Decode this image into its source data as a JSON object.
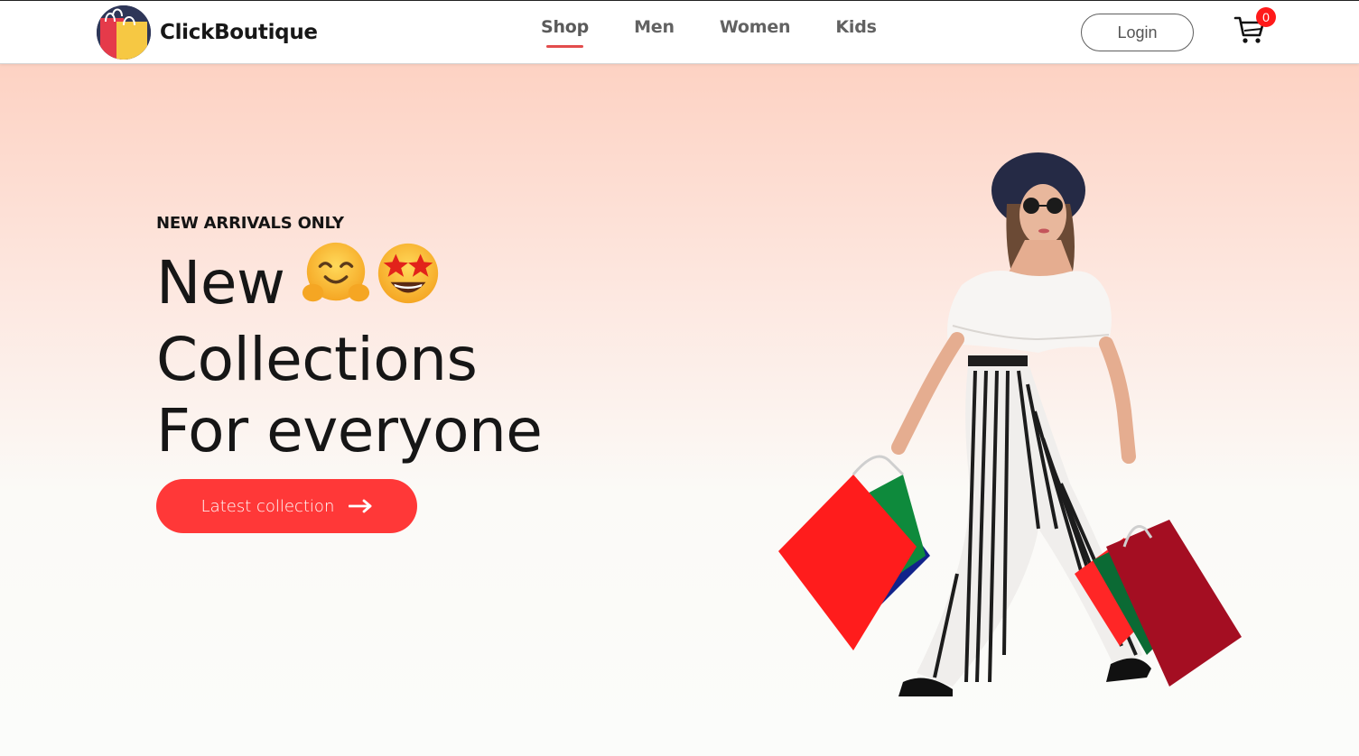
{
  "brand": {
    "name": "ClickBoutique",
    "logo_icon": "shopping-bags-logo-icon"
  },
  "nav": {
    "items": [
      {
        "label": "Shop",
        "active": true
      },
      {
        "label": "Men",
        "active": false
      },
      {
        "label": "Women",
        "active": false
      },
      {
        "label": "Kids",
        "active": false
      }
    ],
    "login_label": "Login",
    "cart_count": "0"
  },
  "hero": {
    "eyebrow": "NEW ARRIVALS ONLY",
    "headline_line1": "New",
    "headline_line2": "Collections",
    "headline_line3": "For everyone",
    "cta_label": "Latest collection",
    "cta_icon": "arrow-right-icon"
  },
  "colors": {
    "accent": "#ff3838",
    "nav_underline": "#e34c4c",
    "badge": "#ff1a1a",
    "hero_top": "#fdd2c3"
  }
}
